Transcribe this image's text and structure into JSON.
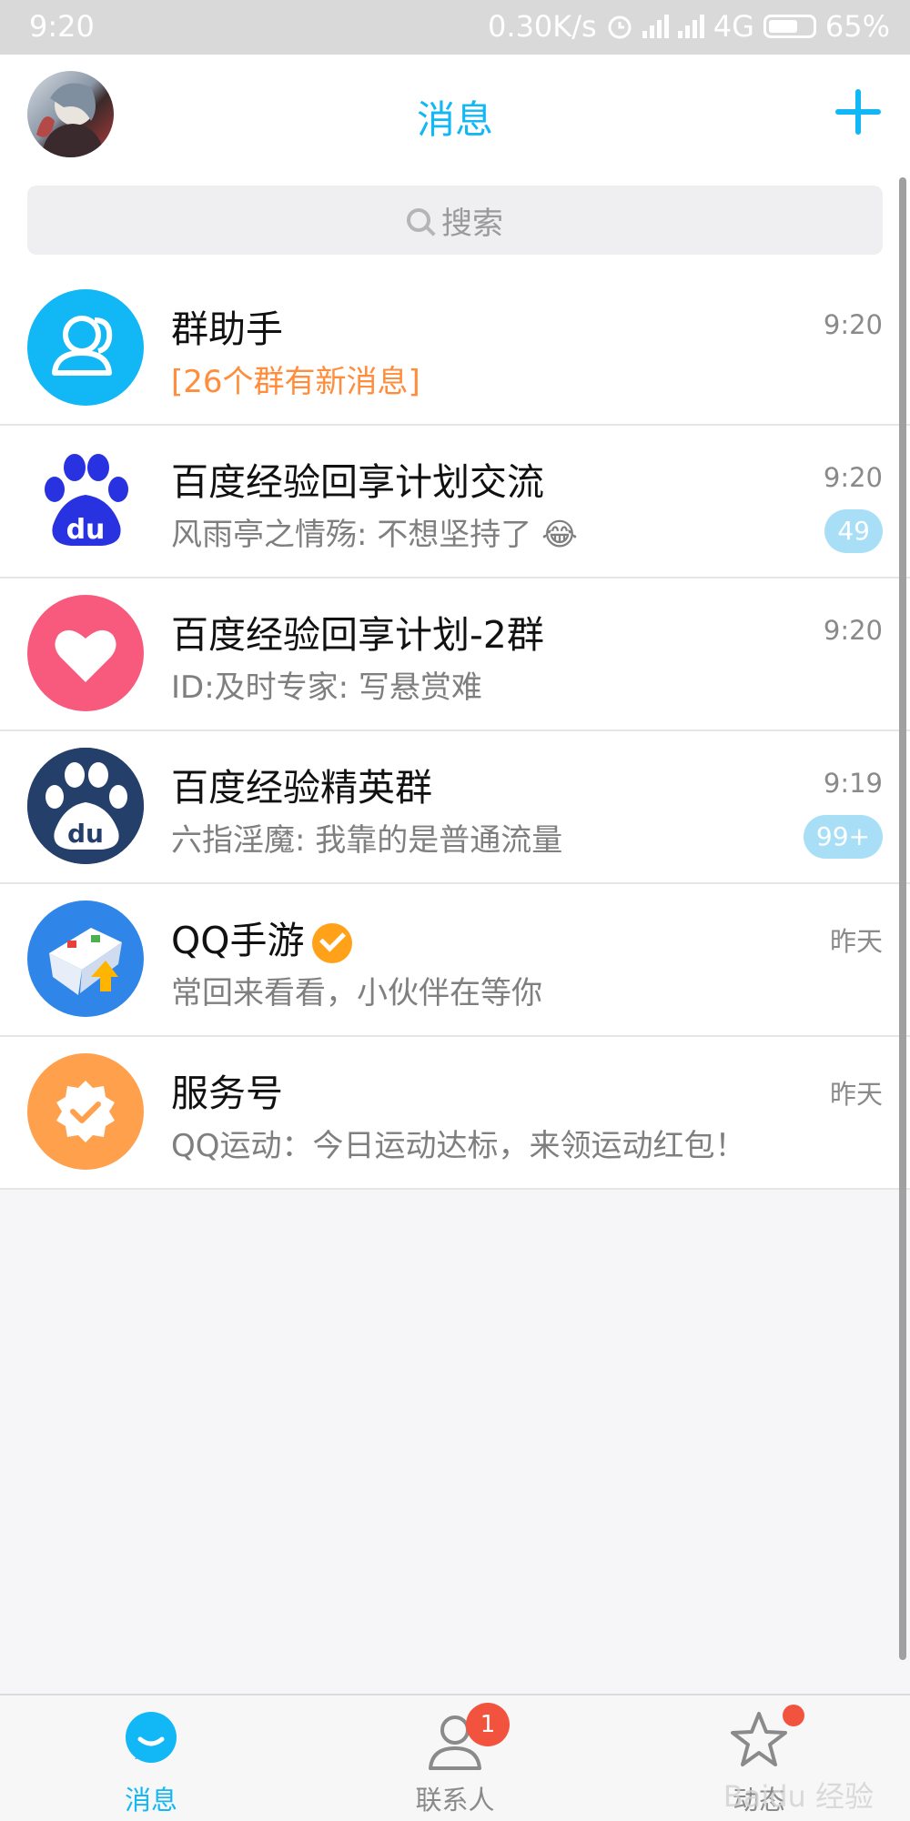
{
  "status": {
    "time": "9:20",
    "speed": "0.30K/s",
    "network": "4G",
    "battery": "65%"
  },
  "header": {
    "title": "消息",
    "avatar": "avatar",
    "add_icon": "plus-icon"
  },
  "search": {
    "placeholder": "搜索"
  },
  "conversations": [
    {
      "name": "群助手",
      "message": "[26个群有新消息]",
      "time": "9:20",
      "badge": ""
    },
    {
      "name": "百度经验回享计划交流",
      "message": "风雨亭之情殇: 不想坚持了 😂",
      "time": "9:20",
      "badge": "49"
    },
    {
      "name": "百度经验回享计划-2群",
      "message": "ID:及时专家: 写悬赏难",
      "time": "9:20",
      "badge": ""
    },
    {
      "name": "百度经验精英群",
      "message": "六指淫魔: 我靠的是普通流量",
      "time": "9:19",
      "badge": "99+"
    },
    {
      "name": "QQ手游",
      "message": "常回来看看，小伙伴在等你",
      "time": "昨天",
      "badge": ""
    },
    {
      "name": "服务号",
      "message": "QQ运动：今日运动达标，来领运动红包！",
      "time": "昨天",
      "badge": ""
    }
  ],
  "tabs": [
    {
      "label": "消息",
      "active": true
    },
    {
      "label": "联系人",
      "badge": "1"
    },
    {
      "label": "动态"
    }
  ],
  "watermark": "Baidu 经验",
  "colors": {
    "accent": "#12b7f5",
    "orange": "#ff8d3c",
    "badge_blue": "#a8dff7",
    "red": "#f2533f"
  }
}
